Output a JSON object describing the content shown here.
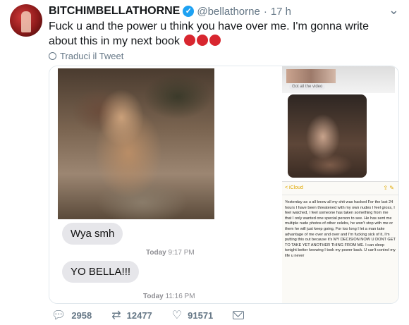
{
  "tweet": {
    "display_name": "BITCHIMBELLATHORNE",
    "handle": "@bellathorne",
    "separator": "·",
    "time": "17 h",
    "text": "Fuck u and the power u think you have over me. I'm gonna write about this in my next book",
    "translate_label": "Traduci il Tweet"
  },
  "media": {
    "left": {
      "bubble1": "Wya smh",
      "ts1_day": "Today",
      "ts1_time": "9:17 PM",
      "bubble2": "YO BELLA!!!",
      "ts2_day": "Today",
      "ts2_time": "11:16 PM"
    },
    "right": {
      "got_videos": "Got all the video",
      "notes_back": "< iCloud",
      "notes_icons": "⇪ ✎",
      "notes_text": "Yesterday as u all know all my shit was hacked For the last 24 hours I have been threatened with my own nudes I feel gross, I feel watched, I feel someone has taken something from me that I only wanted one special person to see. He has sent me multiple nude photos of other celebs, he won't stop with me or them he will just keep going, For too long I let a man take advantage of me over and over and I'm fucking sick of it, I'm putting this out because it's MY DECISION NOW U DONT GET TO TAKE YET ANOTHER THING FROM ME. I can sleep tonight better knowing I took my power back. U can't control my life u never"
    }
  },
  "actions": {
    "replies": "2958",
    "retweets": "12477",
    "likes": "91571"
  },
  "colors": {
    "verified": "#1da1f2",
    "secondary_text": "#657786"
  }
}
